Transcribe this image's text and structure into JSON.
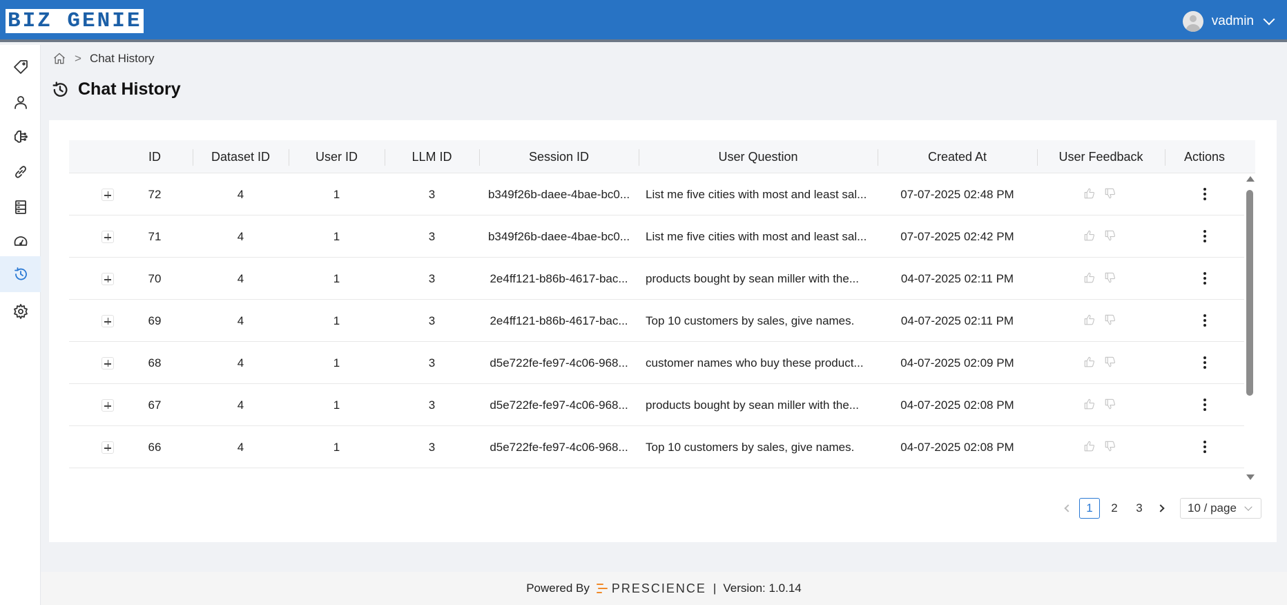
{
  "app": {
    "logo_text": "BIZ GENIE",
    "username": "vadmin"
  },
  "sidebar": {
    "items": [
      {
        "icon": "tag-icon",
        "active": false
      },
      {
        "icon": "user-icon",
        "active": false
      },
      {
        "icon": "brain-icon",
        "active": false
      },
      {
        "icon": "link-icon",
        "active": false
      },
      {
        "icon": "database-icon",
        "active": false
      },
      {
        "icon": "dashboard-gauge-icon",
        "active": false
      },
      {
        "icon": "history-icon",
        "active": true
      },
      {
        "icon": "gear-icon",
        "active": false
      }
    ]
  },
  "breadcrumb": {
    "separator": ">",
    "current": "Chat History"
  },
  "page": {
    "title": "Chat History"
  },
  "table": {
    "columns": [
      "ID",
      "Dataset ID",
      "User ID",
      "LLM ID",
      "Session ID",
      "User Question",
      "Created At",
      "User Feedback",
      "Actions"
    ],
    "rows": [
      {
        "id": "72",
        "dataset_id": "4",
        "user_id": "1",
        "llm_id": "3",
        "session_id": "b349f26b-daee-4bae-bc0...",
        "question": "List me five cities with most and least sal...",
        "created_at": "07-07-2025 02:48 PM"
      },
      {
        "id": "71",
        "dataset_id": "4",
        "user_id": "1",
        "llm_id": "3",
        "session_id": "b349f26b-daee-4bae-bc0...",
        "question": "List me five cities with most and least sal...",
        "created_at": "07-07-2025 02:42 PM"
      },
      {
        "id": "70",
        "dataset_id": "4",
        "user_id": "1",
        "llm_id": "3",
        "session_id": "2e4ff121-b86b-4617-bac...",
        "question": "products bought by sean miller with the...",
        "created_at": "04-07-2025 02:11 PM"
      },
      {
        "id": "69",
        "dataset_id": "4",
        "user_id": "1",
        "llm_id": "3",
        "session_id": "2e4ff121-b86b-4617-bac...",
        "question": "Top 10 customers by sales, give names.",
        "created_at": "04-07-2025 02:11 PM"
      },
      {
        "id": "68",
        "dataset_id": "4",
        "user_id": "1",
        "llm_id": "3",
        "session_id": "d5e722fe-fe97-4c06-968...",
        "question": "customer names who buy these product...",
        "created_at": "04-07-2025 02:09 PM"
      },
      {
        "id": "67",
        "dataset_id": "4",
        "user_id": "1",
        "llm_id": "3",
        "session_id": "d5e722fe-fe97-4c06-968...",
        "question": "products bought by sean miller with the...",
        "created_at": "04-07-2025 02:08 PM"
      },
      {
        "id": "66",
        "dataset_id": "4",
        "user_id": "1",
        "llm_id": "3",
        "session_id": "d5e722fe-fe97-4c06-968...",
        "question": "Top 10 customers by sales, give names.",
        "created_at": "04-07-2025 02:08 PM"
      }
    ]
  },
  "pagination": {
    "pages": [
      "1",
      "2",
      "3"
    ],
    "current": "1",
    "page_size": "10 / page"
  },
  "footer": {
    "powered_by": "Powered By",
    "brand": "PRESCIENCE",
    "divider": "|",
    "version": "Version: 1.0.14"
  },
  "colors": {
    "header": "#2873c4",
    "accent": "#2a79d4",
    "brand_mark": "#f08a2a"
  }
}
